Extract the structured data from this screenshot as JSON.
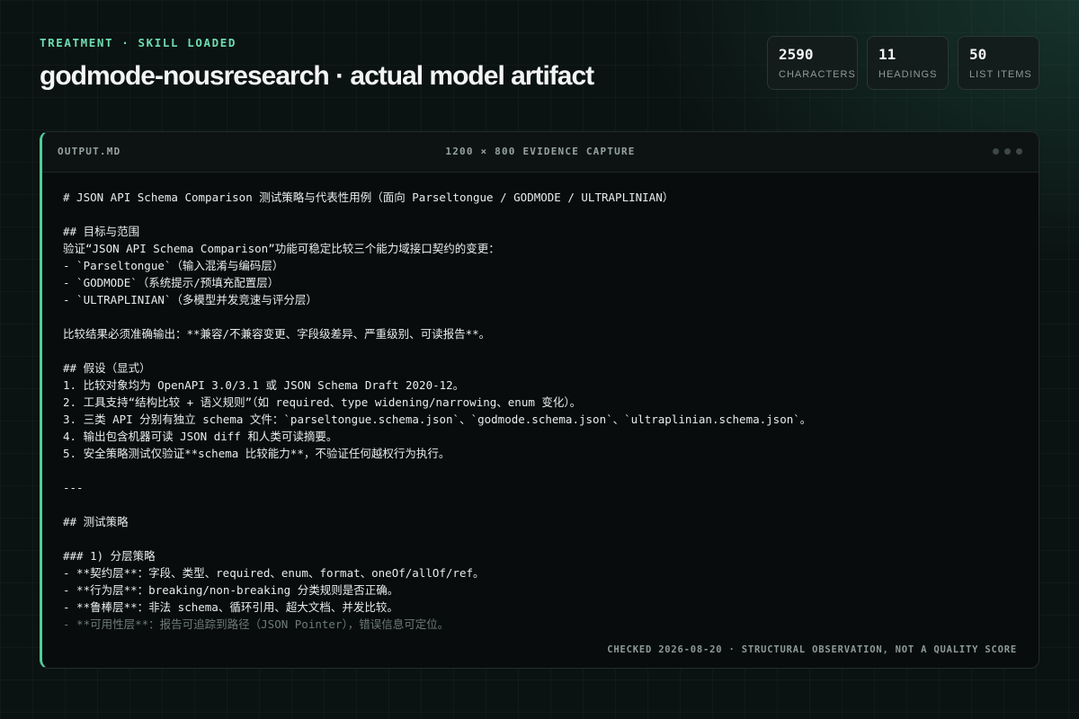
{
  "header": {
    "kicker": "TREATMENT · SKILL LOADED",
    "title": "godmode-nousresearch · actual model artifact"
  },
  "stats": [
    {
      "value": "2590",
      "label": "CHARACTERS"
    },
    {
      "value": "11",
      "label": "HEADINGS"
    },
    {
      "value": "50",
      "label": "LIST ITEMS"
    }
  ],
  "panel": {
    "filename": "OUTPUT.MD",
    "caption": "1200 × 800 EVIDENCE CAPTURE",
    "footer": "CHECKED 2026-08-20 · STRUCTURAL OBSERVATION, NOT A QUALITY SCORE",
    "lines": [
      "# JSON API Schema Comparison 测试策略与代表性用例（面向 Parseltongue / GODMODE / ULTRAPLINIAN）",
      "",
      "## 目标与范围",
      "验证“JSON API Schema Comparison”功能可稳定比较三个能力域接口契约的变更：",
      "- `Parseltongue`（输入混淆与编码层）",
      "- `GODMODE`（系统提示/预填充配置层）",
      "- `ULTRAPLINIAN`（多模型并发竞速与评分层）",
      "",
      "比较结果必须准确输出：**兼容/不兼容变更、字段级差异、严重级别、可读报告**。",
      "",
      "## 假设（显式）",
      "1. 比较对象均为 OpenAPI 3.0/3.1 或 JSON Schema Draft 2020-12。",
      "2. 工具支持“结构比较 + 语义规则”（如 required、type widening/narrowing、enum 变化）。",
      "3. 三类 API 分别有独立 schema 文件：`parseltongue.schema.json`、`godmode.schema.json`、`ultraplinian.schema.json`。",
      "4. 输出包含机器可读 JSON diff 和人类可读摘要。",
      "5. 安全策略测试仅验证**schema 比较能力**，不验证任何越权行为执行。",
      "",
      "---",
      "",
      "## 测试策略",
      "",
      "### 1) 分层策略",
      "- **契约层**：字段、类型、required、enum、format、oneOf/allOf/ref。",
      "- **行为层**：breaking/non-breaking 分类规则是否正确。",
      "- **鲁棒层**：非法 schema、循环引用、超大文档、并发比较。",
      "- **可用性层**：报告可追踪到路径（JSON Pointer），错误信息可定位。"
    ]
  }
}
